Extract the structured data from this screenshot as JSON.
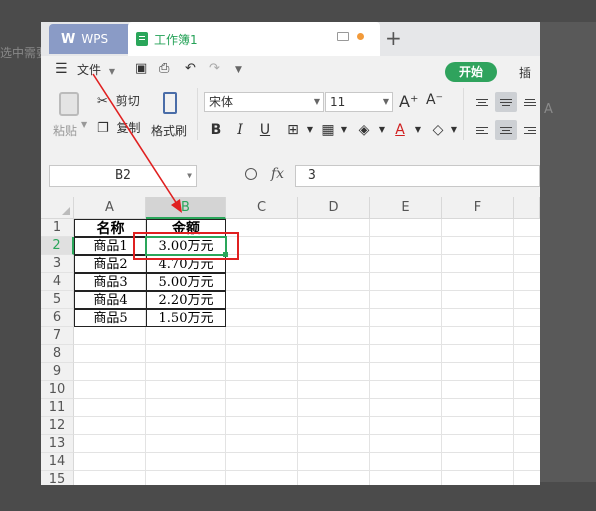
{
  "background": {
    "left_text": "选中需要",
    "right_text": "A"
  },
  "titlebar": {
    "app_tab_label": "WPS",
    "doc_tab_label": "工作簿1",
    "new_tab_symbol": "+"
  },
  "menu": {
    "file_label": "文件",
    "start_label": "开始",
    "insert_label": "插入"
  },
  "ribbon": {
    "paste_label": "粘贴",
    "cut_label": "剪切",
    "copy_label": "复制",
    "format_painter_label": "格式刷",
    "font_name": "宋体",
    "font_size": "11",
    "bold": "B",
    "italic": "I",
    "underline": "U",
    "increase_font": "A⁺",
    "decrease_font": "A⁻",
    "font_color": "A"
  },
  "formula_bar": {
    "name_box": "B2",
    "fx_label": "fx",
    "formula_value": "3"
  },
  "sheet": {
    "columns": [
      "A",
      "B",
      "C",
      "D",
      "E",
      "F"
    ],
    "rows": [
      "1",
      "2",
      "3",
      "4",
      "5",
      "6",
      "7",
      "8",
      "9",
      "10",
      "11",
      "12",
      "13",
      "14",
      "15"
    ],
    "header": {
      "a": "名称",
      "b": "金额"
    },
    "data": [
      {
        "name": "商品1",
        "amount": "3.00万元"
      },
      {
        "name": "商品2",
        "amount": "4.70万元"
      },
      {
        "name": "商品3",
        "amount": "5.00万元"
      },
      {
        "name": "商品4",
        "amount": "2.20万元"
      },
      {
        "name": "商品5",
        "amount": "1.50万元"
      }
    ]
  },
  "colors": {
    "accent_green": "#2aa65a",
    "annotation_red": "#e02020",
    "wps_tab": "#8a9bc6"
  }
}
